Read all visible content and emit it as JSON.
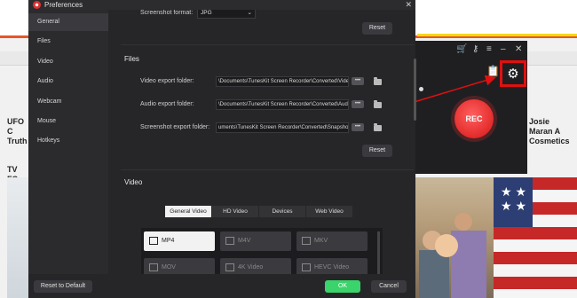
{
  "background": {
    "headlines": {
      "left": "UFO C Truth",
      "left_partial": "TV FC",
      "right": "Josie Maran A Cosmetics"
    }
  },
  "recorder": {
    "rec_label": "REC",
    "icons": [
      "cart-icon",
      "key-icon",
      "menu-icon",
      "minimize-icon",
      "close-icon",
      "clipboard-icon",
      "gear-icon"
    ]
  },
  "dialog": {
    "title": "Preferences",
    "close_symbol": "✕",
    "sidebar": {
      "items": [
        {
          "label": "General",
          "active": true
        },
        {
          "label": "Files",
          "active": false
        },
        {
          "label": "Video",
          "active": false
        },
        {
          "label": "Audio",
          "active": false
        },
        {
          "label": "Webcam",
          "active": false
        },
        {
          "label": "Mouse",
          "active": false
        },
        {
          "label": "Hotkeys",
          "active": false
        }
      ]
    },
    "screenshot": {
      "format_label": "Screenshot format:",
      "format_value": "JPG",
      "reset_label": "Reset"
    },
    "files": {
      "section_title": "Files",
      "video_label": "Video export folder:",
      "video_path": "\\Documents\\TunesKit Screen Recorder\\Converted\\Video\\",
      "audio_label": "Audio export folder:",
      "audio_path": "\\Documents\\TunesKit Screen Recorder\\Converted\\Audio\\",
      "screenshot_label": "Screenshot export folder:",
      "screenshot_path": "uments\\TunesKit Screen Recorder\\Converted\\Snapshot\\",
      "browse_label": "•••",
      "reset_label": "Reset"
    },
    "video": {
      "section_title": "Video",
      "tabs": [
        {
          "label": "General Video",
          "active": true
        },
        {
          "label": "HD Video",
          "active": false
        },
        {
          "label": "Devices",
          "active": false
        },
        {
          "label": "Web Video",
          "active": false
        }
      ],
      "formats": [
        {
          "label": "MP4",
          "active": true
        },
        {
          "label": "M4V",
          "active": false
        },
        {
          "label": "MKV",
          "active": false
        },
        {
          "label": "MOV",
          "active": false
        },
        {
          "label": "4K Video",
          "active": false
        },
        {
          "label": "HEVC Video",
          "active": false
        }
      ]
    },
    "footer": {
      "reset_default_label": "Reset to Default",
      "ok_label": "OK",
      "cancel_label": "Cancel"
    }
  },
  "colors": {
    "accent_red": "#e01010",
    "ok_green": "#3bd36b",
    "rec_red": "#e32b2b"
  }
}
